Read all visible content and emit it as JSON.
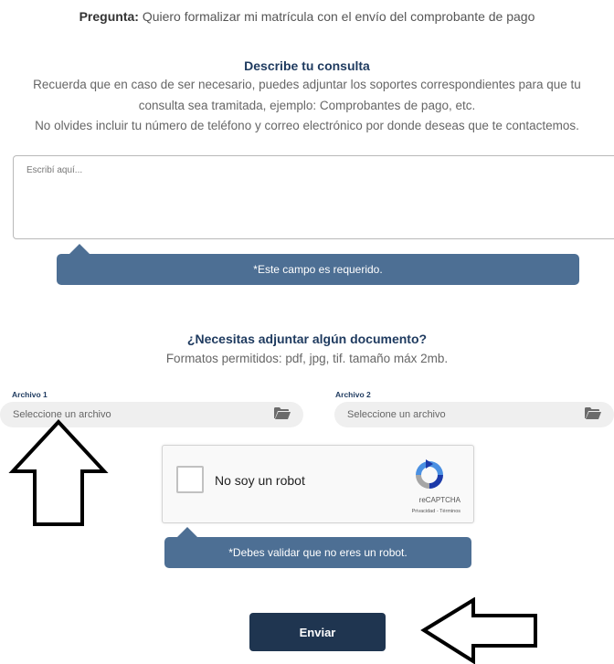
{
  "question": {
    "label": "Pregunta:",
    "text": " Quiero formalizar mi matrícula con el envío del comprobante de pago"
  },
  "describe": {
    "title": "Describe tu consulta",
    "line1": "Recuerda que en caso de ser necesario, puedes adjuntar los soportes correspondientes para que tu",
    "line2": "consulta sea tramitada, ejemplo: Comprobantes de pago, etc.",
    "line3": "No olvides incluir tu número de teléfono y correo electrónico por donde deseas que te contactemos.",
    "placeholder": "Escribí aquí...",
    "value": ""
  },
  "required_tooltip": "*Este campo es requerido.",
  "attachments": {
    "title": "¿Necesitas adjuntar algún documento?",
    "formats": "Formatos permitidos: pdf, jpg, tif. tamaño máx 2mb.",
    "file1": {
      "label": "Archivo 1",
      "placeholder": "Seleccione un archivo"
    },
    "file2": {
      "label": "Archivo 2",
      "placeholder": "Seleccione un archivo"
    }
  },
  "captcha": {
    "label": "No soy un robot",
    "brand": "reCAPTCHA",
    "links": "Privacidad - Términos",
    "checked": false
  },
  "captcha_tooltip": "*Debes validar que no eres un robot.",
  "submit_label": "Enviar",
  "annotations": {
    "arrow_up": "outline-up-arrow",
    "arrow_left": "outline-left-arrow"
  },
  "colors": {
    "navy": "#1e3a5f",
    "tooltip": "#4d6f94",
    "button": "#1f3550"
  }
}
